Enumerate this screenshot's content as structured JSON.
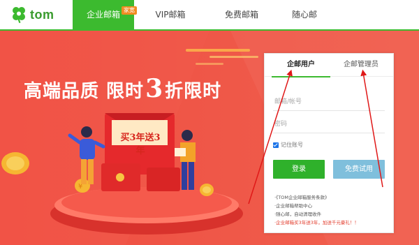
{
  "brand": {
    "name": "tom",
    "color": "#3cba2f"
  },
  "nav": {
    "items": [
      {
        "label": "企业邮箱",
        "badge": "家宽",
        "active": true
      },
      {
        "label": "VIP邮箱"
      },
      {
        "label": "免费邮箱"
      },
      {
        "label": "随心邮"
      }
    ]
  },
  "hero": {
    "headline_pre": "高端品质 限时",
    "headline_num": "3",
    "headline_post": "折限时",
    "envelope_text": "买3年送3年"
  },
  "login": {
    "tabs": [
      "企邮用户",
      "企邮管理员"
    ],
    "account_placeholder": "邮箱/帐号",
    "password_placeholder": "密码",
    "remember_label": "记住账号",
    "login_button": "登录",
    "trial_button": "免费试用",
    "links": [
      "·《TOM企业邮箱服务条款》",
      "·企业邮箱帮助中心",
      "·随心邮，自动清理收件",
      "·企业邮箱买3年送3年，加送千元豪礼！！"
    ]
  },
  "colors": {
    "banner_red": "#f04c40",
    "login_green": "#2fb12b",
    "trial_blue": "#7fbfdc",
    "annotation_red": "#e01818"
  }
}
